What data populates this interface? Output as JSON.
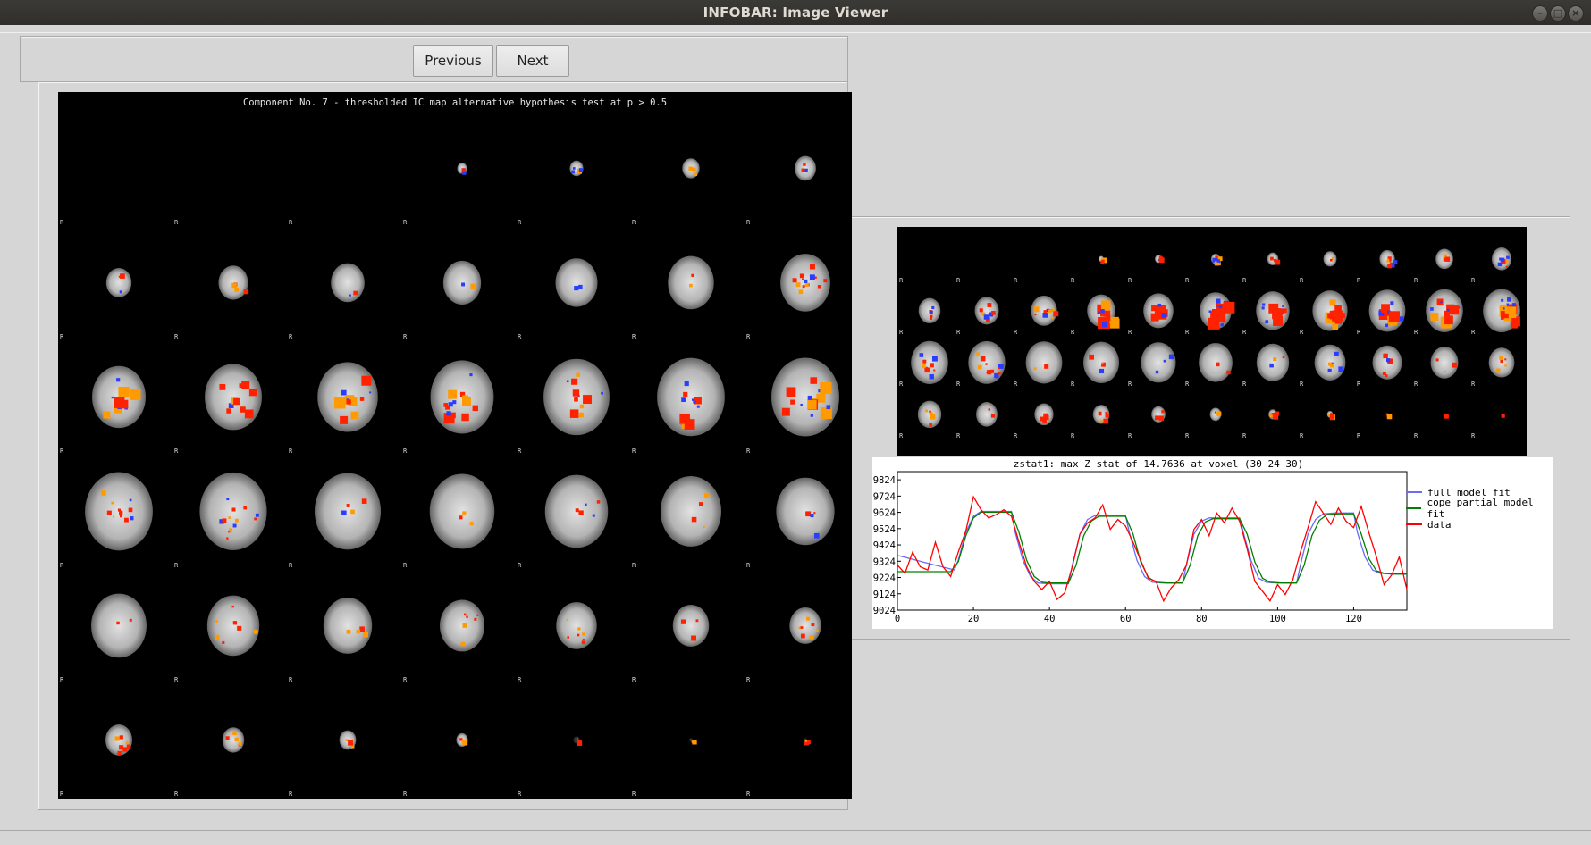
{
  "window": {
    "title": "INFOBAR: Image Viewer",
    "controls": {
      "minimize": "–",
      "maximize": "□",
      "close": "×"
    }
  },
  "nav": {
    "previous_label": "Previous",
    "next_label": "Next"
  },
  "main_image": {
    "caption": "Component No. 7 - thresholded IC map   alternative hypothesis test at p > 0.5",
    "orientation_marker": "R"
  },
  "stat_plot": {
    "title": "zstat1: max Z stat of 14.7636 at voxel (30 24 30)",
    "legend": [
      {
        "name": "full model fit",
        "color": "#6a6aff"
      },
      {
        "name": "cope partial model fit",
        "color": "#008000"
      },
      {
        "name": "data",
        "color": "#ff0000"
      }
    ]
  },
  "chart_data": {
    "type": "line",
    "title": "zstat1: max Z stat of 14.7636 at voxel (30 24 30)",
    "xlabel": "",
    "ylabel": "",
    "xlim": [
      0,
      134
    ],
    "ylim": [
      9024,
      9874
    ],
    "x_ticks": [
      0,
      20,
      40,
      60,
      80,
      100,
      120
    ],
    "y_ticks": [
      9024,
      9124,
      9224,
      9324,
      9424,
      9524,
      9624,
      9724,
      9824
    ],
    "legend_position": "right",
    "series": [
      {
        "name": "full model fit",
        "color": "#6a6aff",
        "x": [
          0,
          5,
          10,
          15,
          16,
          18,
          20,
          22,
          25,
          30,
          31,
          33,
          35,
          37,
          40,
          45,
          46,
          48,
          50,
          52,
          55,
          60,
          61,
          63,
          65,
          67,
          70,
          75,
          76,
          78,
          80,
          82,
          85,
          90,
          91,
          93,
          95,
          97,
          100,
          105,
          106,
          108,
          110,
          112,
          115,
          120,
          121,
          123,
          125,
          127,
          130,
          134
        ],
        "y": [
          9360,
          9330,
          9300,
          9270,
          9330,
          9500,
          9600,
          9630,
          9630,
          9630,
          9500,
          9330,
          9230,
          9190,
          9185,
          9185,
          9300,
          9490,
          9580,
          9605,
          9605,
          9605,
          9500,
          9330,
          9230,
          9195,
          9190,
          9190,
          9300,
          9490,
          9570,
          9590,
          9590,
          9590,
          9500,
          9330,
          9220,
          9195,
          9190,
          9190,
          9300,
          9490,
          9580,
          9615,
          9620,
          9620,
          9500,
          9350,
          9270,
          9250,
          9245,
          9245
        ]
      },
      {
        "name": "cope partial model fit",
        "color": "#008000",
        "x": [
          0,
          5,
          10,
          14,
          16,
          18,
          20,
          22,
          25,
          30,
          32,
          34,
          36,
          38,
          40,
          45,
          47,
          49,
          51,
          53,
          56,
          60,
          62,
          64,
          66,
          68,
          71,
          75,
          77,
          79,
          81,
          83,
          86,
          90,
          92,
          94,
          96,
          98,
          101,
          105,
          107,
          109,
          111,
          113,
          116,
          120,
          122,
          124,
          126,
          128,
          131,
          134
        ],
        "y": [
          9260,
          9260,
          9260,
          9260,
          9320,
          9480,
          9590,
          9625,
          9625,
          9625,
          9500,
          9330,
          9230,
          9195,
          9190,
          9190,
          9300,
          9480,
          9570,
          9600,
          9600,
          9600,
          9490,
          9320,
          9225,
          9195,
          9190,
          9190,
          9300,
          9480,
          9565,
          9585,
          9585,
          9585,
          9490,
          9320,
          9220,
          9195,
          9190,
          9190,
          9300,
          9480,
          9575,
          9610,
          9615,
          9615,
          9490,
          9340,
          9265,
          9250,
          9245,
          9245
        ]
      },
      {
        "name": "data",
        "color": "#ff0000",
        "x": [
          0,
          2,
          4,
          6,
          8,
          10,
          12,
          14,
          16,
          18,
          20,
          22,
          24,
          26,
          28,
          30,
          32,
          34,
          36,
          38,
          40,
          42,
          44,
          46,
          48,
          50,
          52,
          54,
          56,
          58,
          60,
          62,
          64,
          66,
          68,
          70,
          72,
          74,
          76,
          78,
          80,
          82,
          84,
          86,
          88,
          90,
          92,
          94,
          96,
          98,
          100,
          102,
          104,
          106,
          108,
          110,
          112,
          114,
          116,
          118,
          120,
          122,
          124,
          126,
          128,
          130,
          132,
          134
        ],
        "y": [
          9300,
          9250,
          9380,
          9290,
          9270,
          9440,
          9290,
          9230,
          9380,
          9510,
          9720,
          9640,
          9590,
          9610,
          9640,
          9600,
          9440,
          9290,
          9200,
          9150,
          9200,
          9090,
          9130,
          9290,
          9490,
          9560,
          9590,
          9670,
          9520,
          9580,
          9540,
          9440,
          9330,
          9220,
          9200,
          9080,
          9160,
          9210,
          9300,
          9520,
          9580,
          9480,
          9620,
          9560,
          9650,
          9570,
          9400,
          9200,
          9140,
          9080,
          9180,
          9120,
          9210,
          9380,
          9530,
          9690,
          9620,
          9550,
          9650,
          9570,
          9530,
          9660,
          9500,
          9350,
          9180,
          9240,
          9350,
          9150
        ]
      }
    ]
  }
}
